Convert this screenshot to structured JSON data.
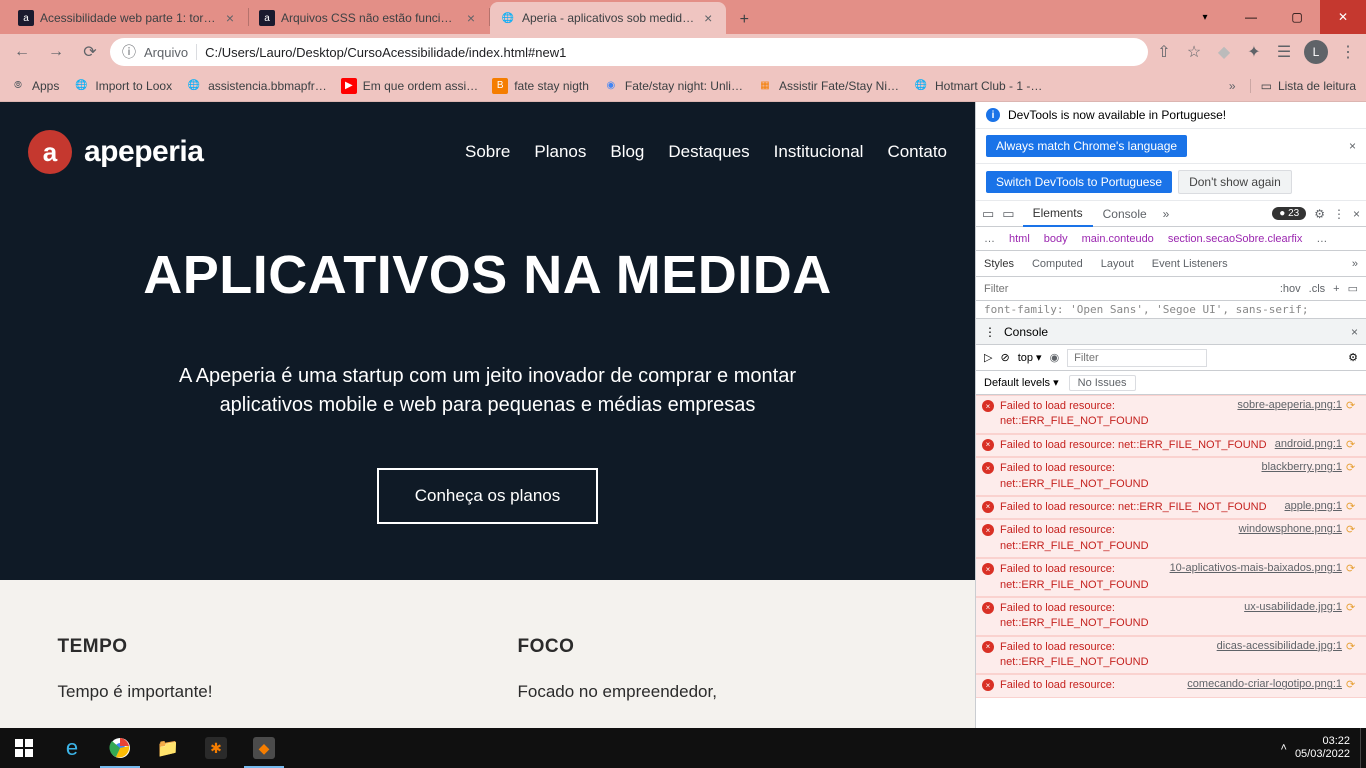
{
  "browser": {
    "tabs": [
      {
        "title": "Acessibilidade web parte 1: torna…",
        "faviconLetter": "a"
      },
      {
        "title": "Arquivos CSS não estão funciona…",
        "faviconLetter": "a"
      },
      {
        "title": "Aperia - aplicativos sob medid…",
        "faviconGlobe": true
      }
    ],
    "activeTab": 2,
    "fileLabel": "Arquivo",
    "url": "C:/Users/Lauro/Desktop/CursoAcessibilidade/index.html#new1",
    "profileLetter": "L"
  },
  "bookmarks": {
    "apps": "Apps",
    "items": [
      "Import to Loox",
      "assistencia.bbmapfr…",
      "Em que ordem assi…",
      "fate stay nigth",
      "Fate/stay night: Unli…",
      "Assistir Fate/Stay Ni…",
      "Hotmart Club - 1 -…"
    ],
    "readingList": "Lista de leitura"
  },
  "page": {
    "logoLetter": "a",
    "logoText": "apeperia",
    "nav": [
      "Sobre",
      "Planos",
      "Blog",
      "Destaques",
      "Institucional",
      "Contato"
    ],
    "heroTitle": "APLICATIVOS NA MEDIDA",
    "heroDesc": "A Apeperia é uma startup com um jeito inovador de comprar e montar aplicativos mobile e web para pequenas e médias empresas",
    "ctaLabel": "Conheça os planos",
    "cols": [
      {
        "title": "TEMPO",
        "text": "Tempo é importante!"
      },
      {
        "title": "FOCO",
        "text": "Focado no empreendedor,"
      }
    ]
  },
  "devtools": {
    "bannerText": "DevTools is now available in Portuguese!",
    "btnMatchLang": "Always match Chrome's language",
    "btnSwitchPt": "Switch DevTools to Portuguese",
    "btnDontShow": "Don't show again",
    "mainTabs": {
      "elements": "Elements",
      "console": "Console"
    },
    "errorCount": "23",
    "breadcrumb": [
      "…",
      "html",
      "body",
      "main.conteudo",
      "section.secaoSobre.clearfix",
      "…"
    ],
    "stylesTabs": [
      "Styles",
      "Computed",
      "Layout",
      "Event Listeners"
    ],
    "filterPlaceholder": "Filter",
    "hov": ":hov",
    "cls": ".cls",
    "cssPeek": "font-family: 'Open Sans', 'Segoe UI', sans-serif;",
    "console": {
      "title": "Console",
      "top": "top",
      "filterPlaceholder": "Filter",
      "defaultLevels": "Default levels",
      "noIssues": "No Issues",
      "errors": [
        {
          "msg": "Failed to load resource: net::ERR_FILE_NOT_FOUND",
          "src": "sobre-apeperia.png:1"
        },
        {
          "msg": "Failed to load resource: net::ERR_FILE_NOT_FOUND",
          "src": "android.png:1"
        },
        {
          "msg": "Failed to load resource: net::ERR_FILE_NOT_FOUND",
          "src": "blackberry.png:1"
        },
        {
          "msg": "Failed to load resource: net::ERR_FILE_NOT_FOUND",
          "src": "apple.png:1"
        },
        {
          "msg": "Failed to load resource: net::ERR_FILE_NOT_FOUND",
          "src": "windowsphone.png:1"
        },
        {
          "msg": "Failed to load resource: net::ERR_FILE_NOT_FOUND",
          "src": "10-aplicativos-mais-baixados.png:1"
        },
        {
          "msg": "Failed to load resource: net::ERR_FILE_NOT_FOUND",
          "src": "ux-usabilidade.jpg:1"
        },
        {
          "msg": "Failed to load resource: net::ERR_FILE_NOT_FOUND",
          "src": "dicas-acessibilidade.jpg:1"
        },
        {
          "msg": "Failed to load resource:",
          "src": "comecando-criar-logotipo.png:1"
        }
      ]
    }
  },
  "taskbar": {
    "time": "03:22",
    "date": "05/03/2022"
  }
}
